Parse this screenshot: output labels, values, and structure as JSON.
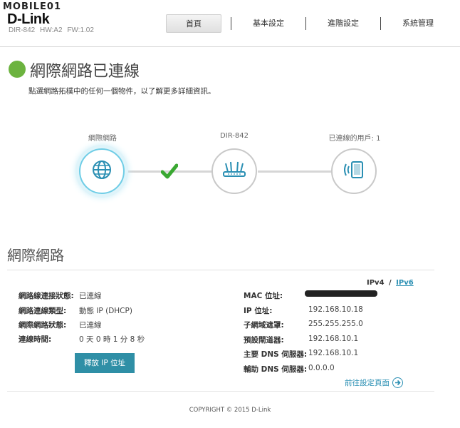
{
  "header": {
    "watermark": "MOBILE01",
    "brand": "D-Link",
    "model": "DIR-842",
    "hw": "HW:A2",
    "fw": "FW:1.02",
    "nav": [
      {
        "label": "首頁",
        "active": true
      },
      {
        "label": "基本設定",
        "active": false
      },
      {
        "label": "進階設定",
        "active": false
      },
      {
        "label": "系統管理",
        "active": false
      }
    ]
  },
  "status": {
    "title": "網際網路已連線",
    "subtitle": "點選網路拓樸中的任何一個物件，以了解更多詳細資訊。",
    "color": "#6cb33f"
  },
  "topology": {
    "internet_label": "網際網路",
    "router_label": "DIR-842",
    "clients_label": "已連線的用戶: 1",
    "internet_icon": "globe-icon",
    "router_icon": "router-icon",
    "clients_icon": "mobile-device-icon",
    "check_icon": "checkmark-icon",
    "check_color": "#3aa832"
  },
  "internet": {
    "section_title": "網際網路",
    "ipv4_label": "IPv4",
    "separator": "/",
    "ipv6_label": "IPv6",
    "left": [
      {
        "key": "網路線連接狀態:",
        "value": "已連線"
      },
      {
        "key": "網路連線類型:",
        "value": "動態 IP (DHCP)"
      },
      {
        "key": "網際網路狀態:",
        "value": "已連線"
      },
      {
        "key": "連線時間:",
        "value": "0 天 0 時 1 分 8 秒"
      }
    ],
    "right": [
      {
        "key": "MAC 位址:",
        "value": ""
      },
      {
        "key": "IP 位址:",
        "value": "192.168.10.18"
      },
      {
        "key": "子網域遮罩:",
        "value": "255.255.255.0"
      },
      {
        "key": "預設閘道器:",
        "value": "192.168.10.1"
      },
      {
        "key": "主要 DNS 伺服器:",
        "value": "192.168.10.1"
      },
      {
        "key": "輔助 DNS 伺服器:",
        "value": "0.0.0.0"
      }
    ],
    "release_button": "釋放 IP 位址",
    "goto_settings": "前往設定頁面"
  },
  "footer": {
    "copyright": "COPYRIGHT © 2015 D-Link"
  }
}
